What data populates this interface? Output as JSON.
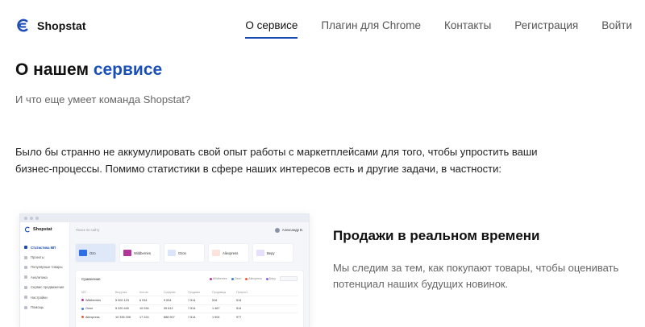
{
  "brand": {
    "name": "Shopstat",
    "accent": "#1b4bb5"
  },
  "nav": [
    {
      "label": "О сервисе",
      "active": true
    },
    {
      "label": "Плагин для Chrome"
    },
    {
      "label": "Контакты"
    },
    {
      "label": "Регистрация"
    },
    {
      "label": "Войти"
    }
  ],
  "hero": {
    "title_plain": "О нашем ",
    "title_accent": "сервисе",
    "subtitle": "И что еще умеет команда Shopstat?",
    "paragraph": "Было бы странно не аккумулировать свой опыт работы с маркетплейсами для того, чтобы упростить ваши бизнес-процессы. Помимо статистики в сфере наших интересов есть и другие задачи, в частности:"
  },
  "preview": {
    "app_name": "Shopstat",
    "search_placeholder": "Поиск по сайту",
    "user_name": "Александр В.",
    "sidebar": [
      "Статистика МП",
      "Проекты",
      "Популярные товары",
      "Аналитика",
      "Сервис продвижения",
      "Настройки",
      "Помощь"
    ],
    "cards": [
      {
        "label": "Ozo",
        "color": "#2f6fe4"
      },
      {
        "label": "Wildberries",
        "color": "#b3359a"
      },
      {
        "label": "Ozon",
        "color": "#3b7ddd"
      },
      {
        "label": "Aliexpress",
        "color": "#f05a3a"
      },
      {
        "label": "Beру",
        "color": "#8a5cf5"
      }
    ],
    "panel_title": "Сравнение",
    "legend": [
      {
        "label": "Wildberries",
        "color": "#b3359a"
      },
      {
        "label": "Ozon",
        "color": "#3b7ddd"
      },
      {
        "label": "Aliexpress",
        "color": "#f05a3a"
      },
      {
        "label": "Беру",
        "color": "#8a5cf5"
      }
    ],
    "columns": [
      "МП",
      "Выручка",
      "Кол-во",
      "Средняя",
      "Продажи",
      "Продавцы",
      "Прирост"
    ],
    "rows": [
      {
        "name": "Wildberries",
        "color": "#b3359a",
        "cells": [
          "5 000 123",
          "6 034",
          "9 534",
          "7.514",
          "516",
          "514"
        ]
      },
      {
        "name": "Ozon",
        "color": "#3b7ddd",
        "cells": [
          "5 220 440",
          "10 034",
          "39 612",
          "7.514",
          "1 467",
          "514"
        ]
      },
      {
        "name": "Aliexpress",
        "color": "#f05a3a",
        "cells": [
          "10 335 206",
          "17 224",
          "888 907",
          "7.514",
          "1 904",
          "977"
        ]
      }
    ]
  },
  "feature": {
    "title": "Продажи в реальном времени",
    "text": "Мы следим за тем, как покупают товары, чтобы оценивать потенциал наших будущих новинок."
  }
}
